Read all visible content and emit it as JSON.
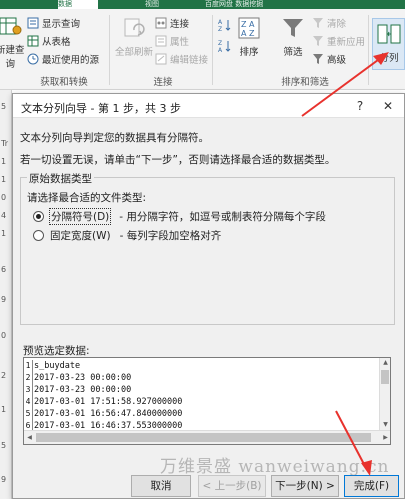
{
  "ribbon": {
    "tabs": [
      "",
      "数据",
      "",
      "视图",
      "",
      "百度网盘 数据挖掘"
    ],
    "get_data": {
      "new_query_label": "新建查",
      "new_query_sub": "询",
      "show_queries": "显示查询",
      "from_table": "从表格",
      "recent_sources": "最近使用的源",
      "group_label": "获取和转换"
    },
    "connections": {
      "refresh_all": "全部刷新",
      "connections": "连接",
      "properties": "属性",
      "edit_links": "编辑链接",
      "group_label": "连接"
    },
    "sort_filter": {
      "sort_az": "A↓Z",
      "sort_za": "Z↓A",
      "sort": "排序",
      "filter": "筛选",
      "clear": "清除",
      "reapply": "重新应用",
      "advanced": "高级",
      "group_label": "排序和筛选"
    },
    "split": {
      "label": "分列"
    }
  },
  "sheet_fragments": [
    "5",
    "Tr",
    "1",
    "1",
    "0",
    "4",
    "1",
    "6",
    "9",
    "0",
    "2",
    "1",
    "5",
    "9"
  ],
  "dialog": {
    "title": "文本分列向导 - 第 1 步，共 3 步",
    "help": "?",
    "close": "✕",
    "intro": "文本分列向导判定您的数据具有分隔符。",
    "instruction": "若一切设置无误，请单击“下一步”，否则请选择最合适的数据类型。",
    "group_title": "原始数据类型",
    "file_type_prompt": "请选择最合适的文件类型:",
    "options": [
      {
        "label": "分隔符号(D)",
        "desc": "- 用分隔字符，如逗号或制表符分隔每个字段",
        "selected": true
      },
      {
        "label": "固定宽度(W)",
        "desc": "- 每列字段加空格对齐",
        "selected": false
      }
    ],
    "preview_label": "预览选定数据:",
    "preview_rows": [
      {
        "num": "1",
        "text": "s_buydate"
      },
      {
        "num": "2",
        "text": "2017-03-23 00:00:00"
      },
      {
        "num": "3",
        "text": "2017-03-23 00:00:00"
      },
      {
        "num": "4",
        "text": "2017-03-01 17:51:58.927000000"
      },
      {
        "num": "5",
        "text": "2017-03-01 16:56:47.840000000"
      },
      {
        "num": "6",
        "text": "2017-03-01 16:46:37.553000000"
      }
    ],
    "buttons": {
      "cancel": "取消",
      "back": "< 上一步(B)",
      "next": "下一步(N) >",
      "finish": "完成(F)"
    }
  },
  "watermark": "万维景盛 wanweiwang.cn",
  "colors": {
    "excel_green": "#217346",
    "arrow_red": "#e8322d",
    "focus_blue": "#0078d7"
  }
}
